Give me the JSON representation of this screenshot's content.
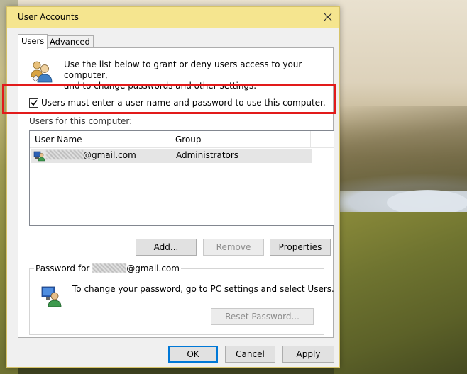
{
  "window": {
    "title": "User Accounts"
  },
  "tabs": [
    {
      "label": "Users",
      "active": true
    },
    {
      "label": "Advanced",
      "active": false
    }
  ],
  "intro": {
    "line1": "Use the list below to grant or deny users access to your computer,",
    "line2": "and to change passwords and other settings."
  },
  "require_login": {
    "checked": true,
    "label": "Users must enter a user name and password to use this computer."
  },
  "users_section": {
    "label": "Users for this computer:",
    "columns": [
      "User Name",
      "Group"
    ],
    "rows": [
      {
        "name_suffix": "@gmail.com",
        "group": "Administrators",
        "selected": true
      }
    ]
  },
  "user_buttons": {
    "add": "Add...",
    "remove": "Remove",
    "properties": "Properties"
  },
  "password_group": {
    "legend_prefix": "Password for ",
    "legend_suffix": "@gmail.com",
    "text": "To change your password, go to PC settings and select Users.",
    "reset_button": "Reset Password..."
  },
  "dialog_buttons": {
    "ok": "OK",
    "cancel": "Cancel",
    "apply": "Apply"
  },
  "colors": {
    "titlebar": "#f5e58f",
    "highlight": "#e21a1a",
    "default_button_border": "#0078d7"
  }
}
